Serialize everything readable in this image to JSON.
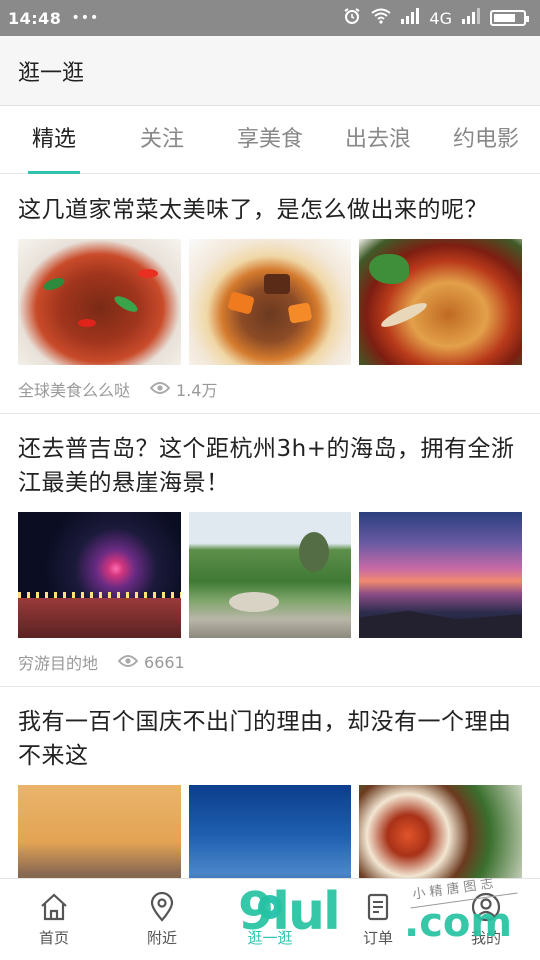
{
  "status_bar": {
    "time": "14:48",
    "notification_dots": "•••",
    "network_label": "4G",
    "battery_level": 0.75,
    "icons": [
      "alarm-icon",
      "wifi-icon",
      "signal-icon",
      "signal-icon",
      "battery-icon"
    ]
  },
  "header": {
    "title": "逛一逛"
  },
  "tabs": [
    {
      "label": "精选",
      "active": true
    },
    {
      "label": "关注",
      "active": false
    },
    {
      "label": "享美食",
      "active": false
    },
    {
      "label": "出去浪",
      "active": false
    },
    {
      "label": "约电影",
      "active": false
    }
  ],
  "feed": [
    {
      "title": "这几道家常菜太美味了，是怎么做出来的呢？",
      "source": "全球美食么么哒",
      "views": "1.4万",
      "images": [
        "spicy-beef-dish",
        "braised-stew-pot",
        "chili-chicken-plate"
      ]
    },
    {
      "title": "还去普吉岛？这个距杭州3h+的海岛，拥有全浙江最美的悬崖海景！",
      "source": "穷游目的地",
      "views": "6661",
      "images": [
        "fireworks-night",
        "island-park",
        "cliff-sunset"
      ]
    },
    {
      "title": "我有一百个国庆不出门的理由，却没有一个理由不来这",
      "images": [
        "city-skyline",
        "blue-sky",
        "food-table"
      ]
    }
  ],
  "bottom_nav": [
    {
      "label": "首页",
      "icon": "home-icon",
      "active": false
    },
    {
      "label": "附近",
      "icon": "location-pin-icon",
      "active": false
    },
    {
      "label": "逛一逛",
      "icon": "browse-icon",
      "active": true
    },
    {
      "label": "订单",
      "icon": "order-icon",
      "active": false
    },
    {
      "label": "我的",
      "icon": "profile-icon",
      "active": false
    }
  ],
  "watermark": {
    "logo": "9lul",
    "domain": ".com",
    "script": "小 精 唐 图 志"
  },
  "colors": {
    "accent": "#2fc4b2",
    "statusbar": "#8a8a8a",
    "meta_text": "#999999"
  }
}
